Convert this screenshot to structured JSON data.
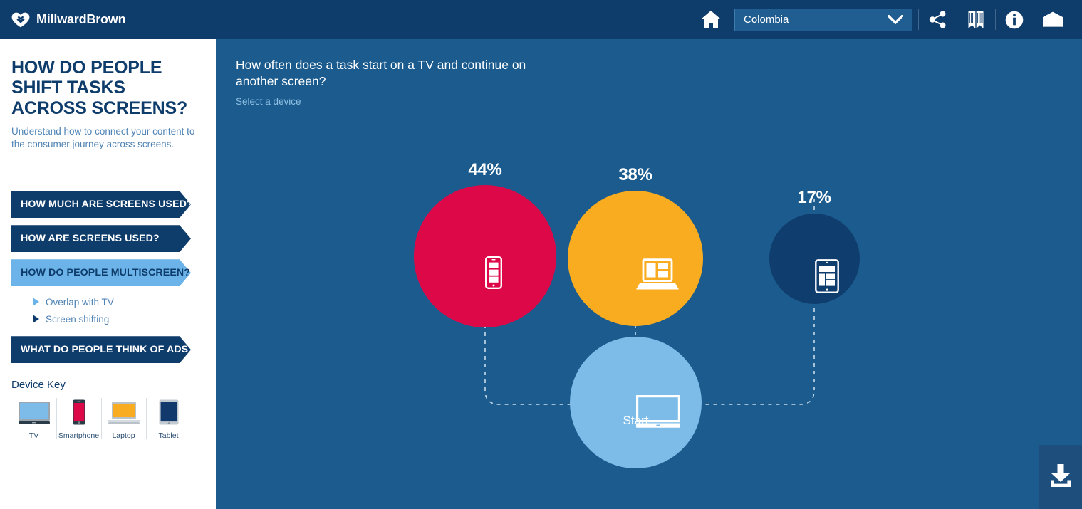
{
  "topbar": {
    "brand_name": "MillwardBrown",
    "brand_icon": "heart-logo-icon",
    "home_icon": "home-icon",
    "share_icon": "share-icon",
    "book_icon": "book-icon",
    "info_icon": "info-icon",
    "mail_icon": "envelope-icon",
    "country": {
      "value": "Colombia",
      "caret_icon": "chevron-down-icon"
    }
  },
  "sidebar": {
    "title": "HOW DO PEOPLE SHIFT TASKS ACROSS SCREENS?",
    "subtitle": "Understand how to connect your content to the consumer journey across screens.",
    "nav": [
      {
        "label": "HOW MUCH ARE SCREENS USED?",
        "active": false
      },
      {
        "label": "HOW ARE SCREENS USED?",
        "active": false
      },
      {
        "label": "HOW DO PEOPLE MULTISCREEN?",
        "active": true
      },
      {
        "label": "WHAT DO PEOPLE THINK OF ADS?",
        "active": false
      }
    ],
    "subitems": [
      {
        "label": "Overlap with TV",
        "current": false
      },
      {
        "label": "Screen shifting",
        "current": true
      }
    ],
    "device_key": {
      "title": "Device Key",
      "devices": [
        {
          "name": "TV",
          "icon": "tv-icon",
          "color": "#7DBCE8"
        },
        {
          "name": "Smartphone",
          "icon": "smartphone-icon",
          "color": "#DD0848"
        },
        {
          "name": "Laptop",
          "icon": "laptop-icon",
          "color": "#F9AC20"
        },
        {
          "name": "Tablet",
          "icon": "tablet-icon",
          "color": "#0F3D6E"
        }
      ]
    }
  },
  "main": {
    "question": "How often does a task start on a TV and continue on another screen?",
    "instruction": "Select a device",
    "download_icon": "download-icon"
  },
  "chart_data": {
    "type": "bubble",
    "title": "How often does a task start on a TV and continue on another screen?",
    "start_node": {
      "label": "Start",
      "device": "TV",
      "icon": "tv-icon",
      "color": "#7DBCE8"
    },
    "categories": [
      "Smartphone",
      "Laptop",
      "Tablet"
    ],
    "values": [
      44,
      38,
      17
    ],
    "value_labels": [
      "44%",
      "38%",
      "17%"
    ],
    "series": [
      {
        "name": "Smartphone",
        "value": 44,
        "label": "44%",
        "color": "#DD0848",
        "icon": "smartphone-icon"
      },
      {
        "name": "Laptop",
        "value": 38,
        "label": "38%",
        "color": "#F9AC20",
        "icon": "laptop-icon"
      },
      {
        "name": "Tablet",
        "value": 17,
        "label": "17%",
        "color": "#0F3D6E",
        "icon": "tablet-icon"
      }
    ],
    "unit": "percent",
    "connector_style": "dashed",
    "legend": "Device Key",
    "background": "#1B5B8E"
  }
}
